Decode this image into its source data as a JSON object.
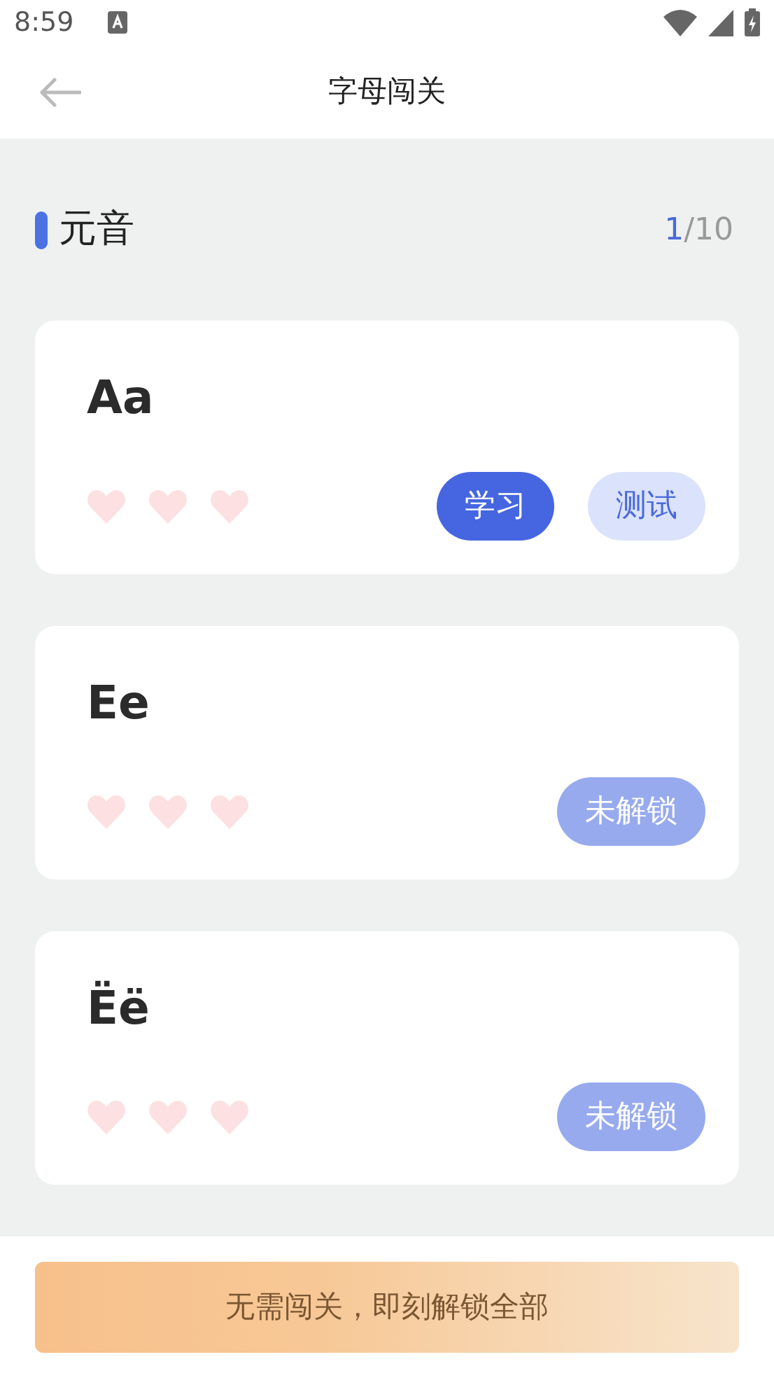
{
  "status_bar": {
    "time": "8:59"
  },
  "header": {
    "title": "字母闯关"
  },
  "section": {
    "title": "元音",
    "current": "1",
    "total": "/10"
  },
  "levels": [
    {
      "letter": "Aa",
      "buttons": [
        {
          "label": "学习",
          "kind": "primary"
        },
        {
          "label": "测试",
          "kind": "secondary"
        }
      ]
    },
    {
      "letter": "Ee",
      "buttons": [
        {
          "label": "未解锁",
          "kind": "locked"
        }
      ]
    },
    {
      "letter": "Ëë",
      "buttons": [
        {
          "label": "未解锁",
          "kind": "locked"
        }
      ]
    }
  ],
  "footer": {
    "button": "无需闯关，即刻解锁全部"
  }
}
